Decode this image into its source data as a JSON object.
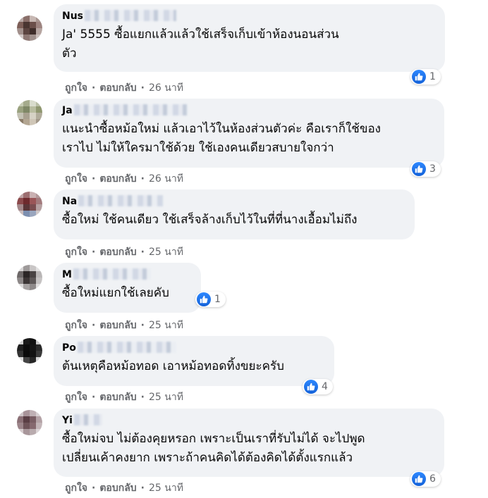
{
  "comments": [
    {
      "author": "Nus",
      "text_lines": [
        "Ja'        5555 ซื้อแยกแล้วแล้วใช้เสร็จเก็บเข้าห้องนอนส่วน",
        "ตัว"
      ],
      "reaction_count": "1",
      "like_label": "ถูกใจ",
      "reply_label": "ตอบกลับ",
      "time": "26 นาที"
    },
    {
      "author": "Ja",
      "text_lines": [
        "แนะนำซื้อหม้อใหม่ แล้วเอาไว้ในห้องส่วนตัวค่ะ คือเราก็ใช้ของ",
        "เราไป ไม่ให้ใครมาใช้ด้วย ใช้เองคนเดียวสบายใจกว่า"
      ],
      "reaction_count": "3",
      "like_label": "ถูกใจ",
      "reply_label": "ตอบกลับ",
      "time": "26 นาที"
    },
    {
      "author": "Na",
      "text_lines": [
        "ซื้อใหม่ ใช้คนเดียว ใช้เสร็จล้างเก็บไว้ในที่ที่นางเอื้อมไม่ถึง"
      ],
      "reaction_count": "",
      "like_label": "ถูกใจ",
      "reply_label": "ตอบกลับ",
      "time": "25 นาที"
    },
    {
      "author": "M",
      "text_lines": [
        "ซื้อใหม่แยกใช้เลยคับ"
      ],
      "reaction_count": "1",
      "like_label": "ถูกใจ",
      "reply_label": "ตอบกลับ",
      "time": "25 นาที"
    },
    {
      "author": "Po",
      "text_lines": [
        "ต้นเหตุคือหม้อทอด เอาหม้อทอดทิ้งขยะครับ"
      ],
      "reaction_count": "4",
      "like_label": "ถูกใจ",
      "reply_label": "ตอบกลับ",
      "time": "25 นาที"
    },
    {
      "author": "Yi",
      "text_lines": [
        "ซื้อใหม่จบ ไม่ต้องคุยหรอก เพราะเป็นเราที่รับไม่ได้ จะไปพูด",
        "เปลี่ยนเค้าคงยาก เพราะถ้าคนคิดได้ต้องคิดได้ตั้งแรกแล้ว"
      ],
      "reaction_count": "6",
      "like_label": "ถูกใจ",
      "reply_label": "ตอบกลับ",
      "time": "25 นาที"
    }
  ],
  "colors": {
    "bubble_bg": "#f0f2f5",
    "secondary_text": "#65676b",
    "like_blue": "#1877f2"
  }
}
